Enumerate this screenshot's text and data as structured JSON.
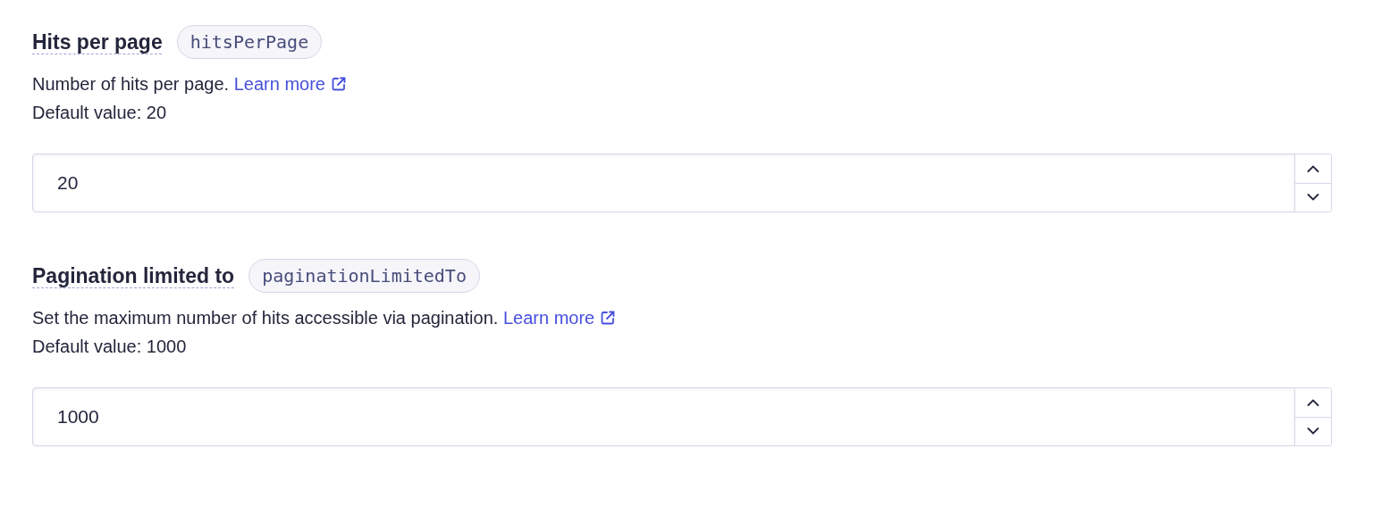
{
  "settings": [
    {
      "label": "Hits per page",
      "parameter": "hitsPerPage",
      "description": "Number of hits per page.",
      "link": "Learn more",
      "default": "Default value: 20",
      "value": "20"
    },
    {
      "label": "Pagination limited to",
      "parameter": "paginationLimitedTo",
      "description": "Set the maximum number of hits accessible via pagination.",
      "link": "Learn more",
      "default": "Default value: 1000",
      "value": "1000"
    }
  ]
}
